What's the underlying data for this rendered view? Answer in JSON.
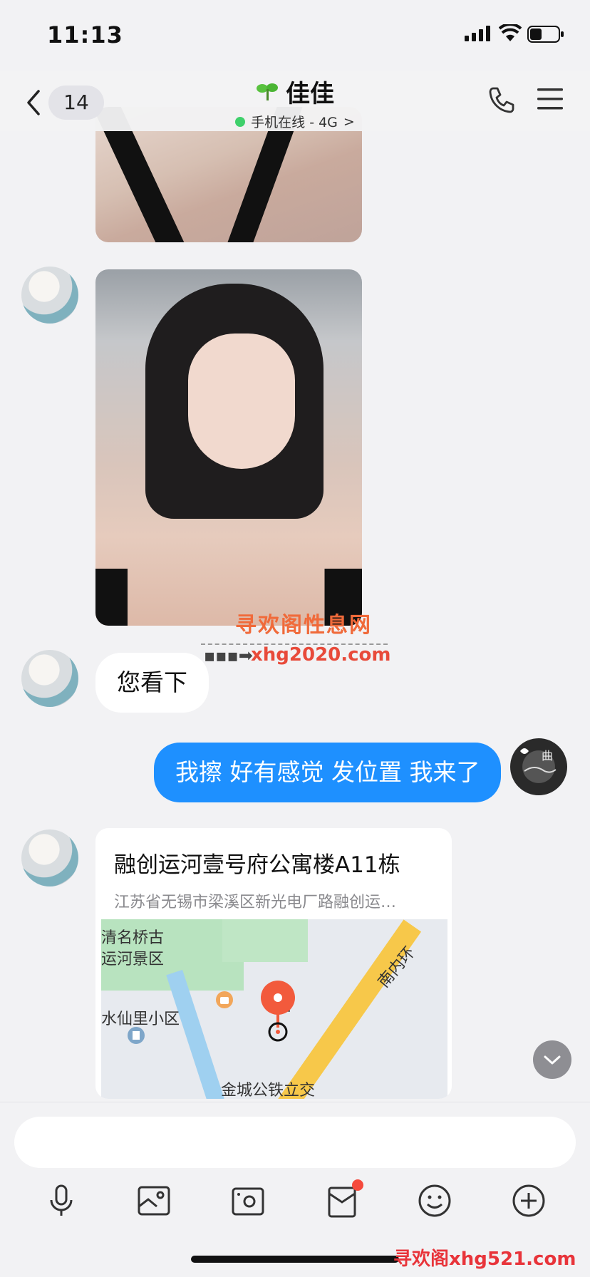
{
  "status": {
    "time": "11:13",
    "icons": [
      "signal-icon",
      "wifi-icon",
      "battery-icon"
    ]
  },
  "header": {
    "unread_count": "14",
    "contact_name": "佳佳",
    "sprout_icon": "sprout-icon",
    "presence": "手机在线 - 4G",
    "presence_arrow": ">",
    "online_color": "#3fd06b"
  },
  "messages": [
    {
      "type": "image",
      "sender": "contact"
    },
    {
      "type": "image",
      "sender": "contact"
    },
    {
      "type": "text",
      "sender": "contact",
      "text": "您看下"
    },
    {
      "type": "text",
      "sender": "me",
      "text": "我擦 好有感觉 发位置 我来了"
    },
    {
      "type": "location",
      "sender": "contact",
      "name": "融创运河壹号府公寓楼A11栋",
      "address": "江苏省无锡市梁溪区新光电厂路融创运…",
      "map_labels": [
        "清名桥古",
        "运河景区",
        "水仙里小区",
        "南内环",
        "金城公铁立交",
        "汇"
      ]
    }
  ],
  "watermarks": {
    "center_title": "寻欢阁性息网",
    "center_url": "xhg2020.com",
    "bottom": "寻欢阁xhg521.com"
  },
  "input": {
    "placeholder": ""
  },
  "toolbar": [
    "microphone-icon",
    "image-icon",
    "camera-icon",
    "red-packet-icon",
    "emoji-icon",
    "plus-icon"
  ],
  "colors": {
    "accent": "#1e90ff",
    "background": "#f2f2f4",
    "badge_red": "#f5493c"
  }
}
